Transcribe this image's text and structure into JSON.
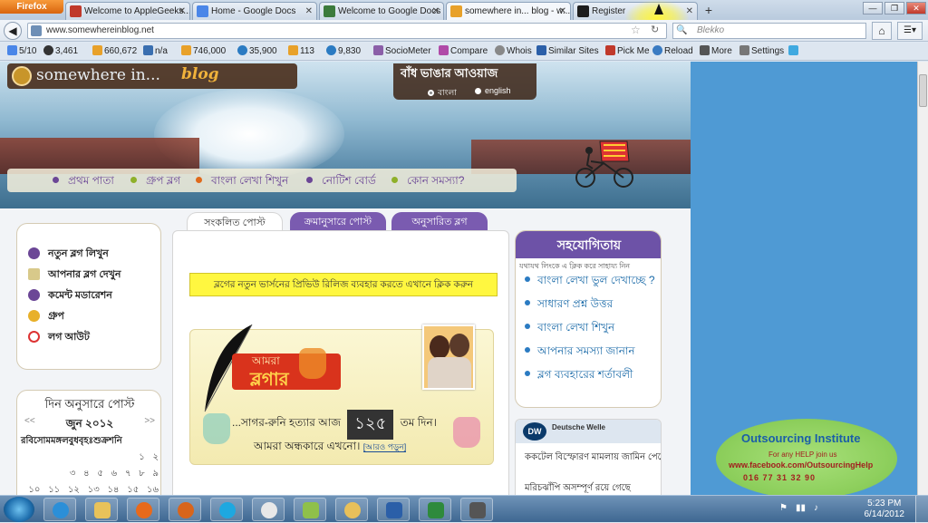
{
  "browser": {
    "app_button": "Firefox",
    "tabs": [
      {
        "label": "Welcome to AppleGeeks....",
        "color": "#c0392b"
      },
      {
        "label": "Home - Google Docs",
        "color": "#4a86e8"
      },
      {
        "label": "Welcome to Google Docs",
        "color": "#3c7b3c"
      },
      {
        "label": "somewhere in... blog - w...",
        "color": "#e8a12a"
      },
      {
        "label": "Register",
        "color": "#1d1d1d"
      }
    ],
    "url": "www.somewhereinblog.net",
    "search_placeholder": "Blekko",
    "window_controls": [
      "—",
      "❐",
      "✕"
    ]
  },
  "toolbar": {
    "items": [
      "5/10",
      "3,461",
      "660,672",
      "n/a",
      "746,000",
      "35,900",
      "113",
      "9,830",
      "SocioMeter",
      "Compare",
      "Whois",
      "Similar Sites",
      "Pick Me",
      "Reload",
      "More",
      "Settings"
    ]
  },
  "site": {
    "logo_text_1": "somewhere in...",
    "logo_text_2": "blog",
    "slogan": "বাঁধ ভাঙার আওয়াজ",
    "lang_bn": "বাংলা",
    "lang_en": "english",
    "nav": [
      "প্রথম পাতা",
      "গ্রুপ ব্লগ",
      "বাংলা লেখা শিখুন",
      "নোটিশ বোর্ড",
      "কোন সমস্যা?"
    ],
    "left_menu": [
      "নতুন ব্লগ লিখুন",
      "আপনার ব্লগ দেখুন",
      "কমেন্ট মডারেশন",
      "গ্রুপ",
      "লগ আউট"
    ],
    "post_tabs": [
      "সংকলিত পোস্ট",
      "ক্রমানুসারে পোস্ট",
      "অনুসারিত ব্লগ"
    ],
    "notice": "ব্লগের নতুন ভার্সনের প্রিভিউ রিলিজ ব্যবহার করতে এখানে ক্লিক করুন",
    "promo": {
      "amra": "আমরা",
      "blogger": "ব্লগার",
      "line1_pre": "...সাগর-রুনি হত্যার আজ",
      "count": "১২৫",
      "line1_post": "তম দিন।",
      "line2": "আমরা অন্ধকারে এখনো।",
      "more": "[আরও পড়ুন]"
    },
    "calendar": {
      "title": "দিন অনুসারে পোস্ট",
      "month": "জুন ২০১২",
      "prev": "<<",
      "next": ">>",
      "days": "রবিসোমমঙ্গলবুধবৃহঃশুক্রশনি",
      "row1": "১ ২",
      "row2": "৩ ৪ ৫ ৬ ৭ ৮ ৯",
      "row3": "১০ ১১ ১২ ১৩ ১৪ ১৫ ১৬"
    },
    "help_box": {
      "title": "সহযোগিতায়",
      "subtitle": "যথাযথ লিংকে এ ক্লিক করে সাহায্য নিন",
      "items": [
        "বাংলা লেখা ভুল দেখাচ্ছে ?",
        "সাধারণ প্রশ্ন উত্তর",
        "বাংলা লেখা শিখুন",
        "আপনার সমস্যা জানান",
        "ব্লগ ব্যবহারের শর্তাবলী"
      ]
    },
    "dw": {
      "logo": "DW",
      "name": "Deutsche Welle",
      "items": [
        "ককটেল বিস্ফোরণ মামলায় জামিন পেলেন ১৫ জন",
        "মরিচঝাঁপি অসম্পূর্ণ রয়ে গেছে"
      ]
    }
  },
  "watermark": {
    "title": "Outsourcing Institute",
    "line": "For any HELP join us",
    "url": "www.facebook.com/OutsourcingHelp",
    "phone": "016 77 31 32 90"
  },
  "taskbar": {
    "time": "5:23 PM",
    "date": "6/14/2012"
  }
}
